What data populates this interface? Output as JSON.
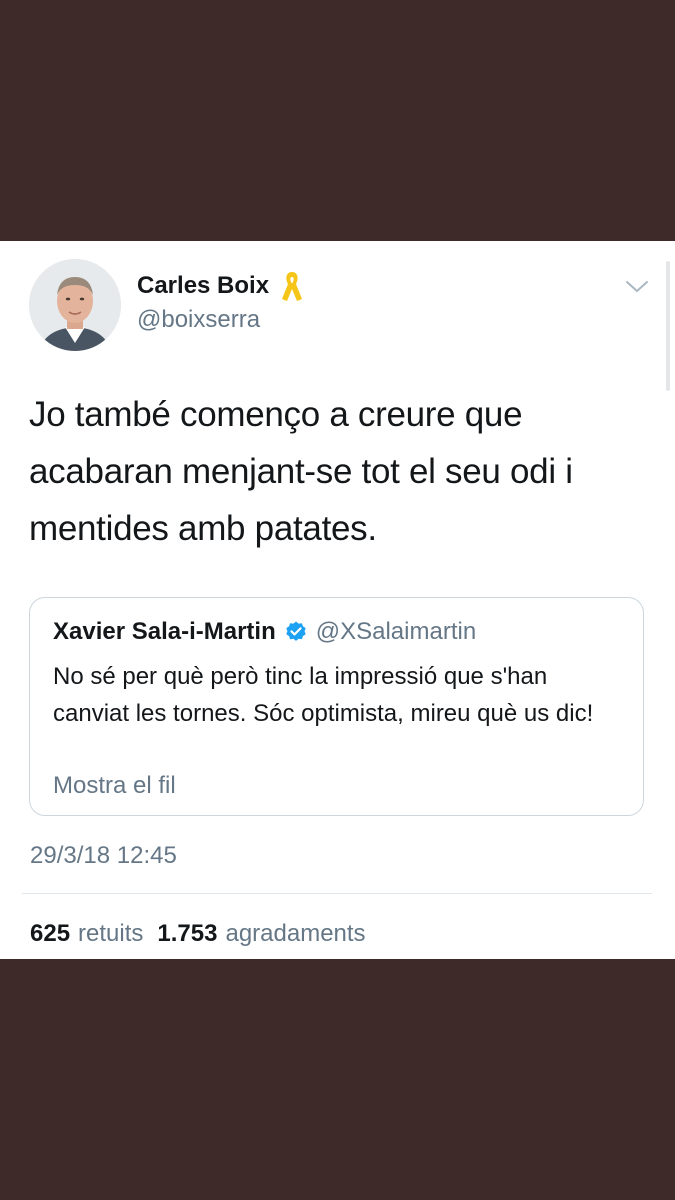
{
  "tweet": {
    "author": {
      "display_name": "Carles Boix",
      "handle": "@boixserra"
    },
    "text": "Jo també començo a creure que acabaran menjant-se tot el seu odi i mentides amb patates.",
    "timestamp": "29/3/18 12:45",
    "stats": {
      "retweets_count": "625",
      "retweets_label": "retuits",
      "likes_count": "1.753",
      "likes_label": "agradaments"
    }
  },
  "quoted_tweet": {
    "author": {
      "display_name": "Xavier Sala-i-Martin",
      "handle": "@XSalaimartin",
      "verified": true
    },
    "text": "No sé per què però tinc la impressió que s'han canviat les tornes. Sóc optimista, mireu què us dic!",
    "show_thread_label": "Mostra el fil"
  },
  "icons": {
    "ribbon": "yellow-ribbon-icon",
    "verified": "verified-badge-icon",
    "menu": "chevron-down-icon"
  },
  "colors": {
    "background": "#3e2a28",
    "card": "#ffffff",
    "primary_text": "#14171a",
    "secondary_text": "#657786",
    "verified_blue": "#1da1f2",
    "ribbon_yellow": "#f5c518"
  }
}
